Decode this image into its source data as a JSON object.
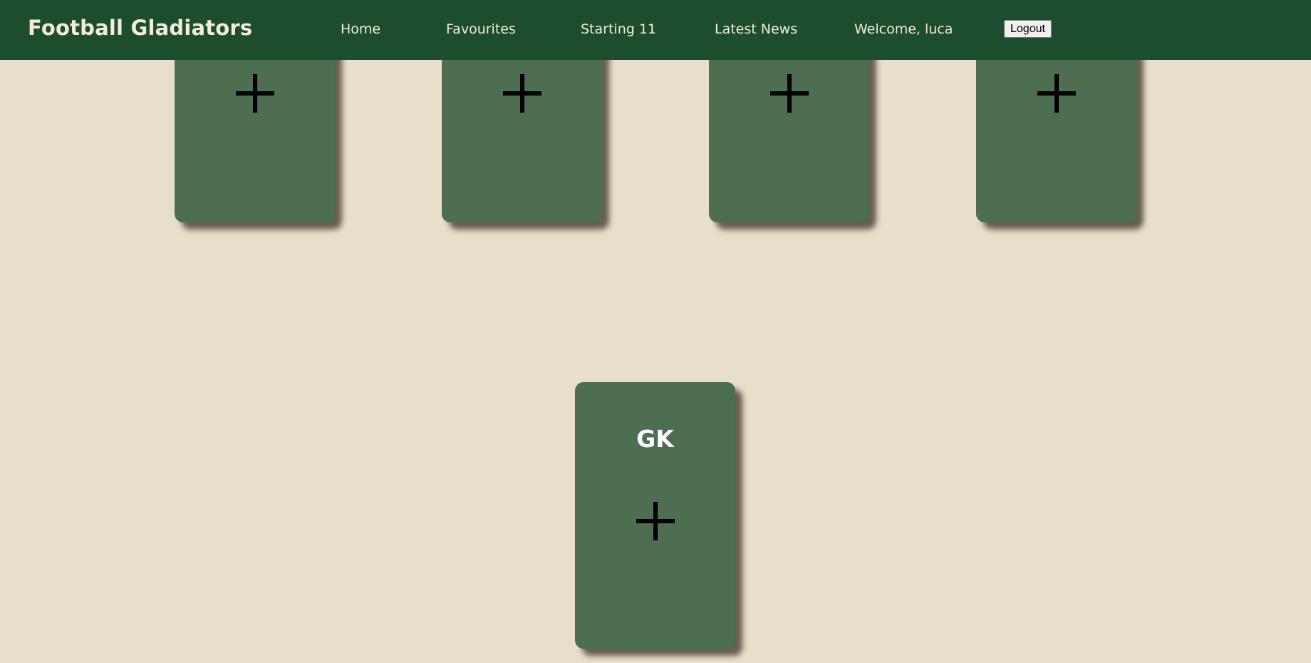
{
  "navbar": {
    "brand": "Football Gladiators",
    "links": [
      {
        "label": "Home"
      },
      {
        "label": "Favourites"
      },
      {
        "label": "Starting 11"
      },
      {
        "label": "Latest News"
      }
    ],
    "welcome": "Welcome, luca",
    "logout_label": "Logout"
  },
  "colors": {
    "navbar_bg": "#1b4d2e",
    "page_bg": "#e7dfc9",
    "card_bg": "#4e6e51",
    "nav_text": "#f3ecd8"
  },
  "formation": {
    "top_row": [
      {
        "position": "",
        "icon": "plus-icon"
      },
      {
        "position": "",
        "icon": "plus-icon"
      },
      {
        "position": "",
        "icon": "plus-icon"
      },
      {
        "position": "",
        "icon": "plus-icon"
      }
    ],
    "goalkeeper": {
      "position": "GK",
      "icon": "plus-icon"
    }
  }
}
